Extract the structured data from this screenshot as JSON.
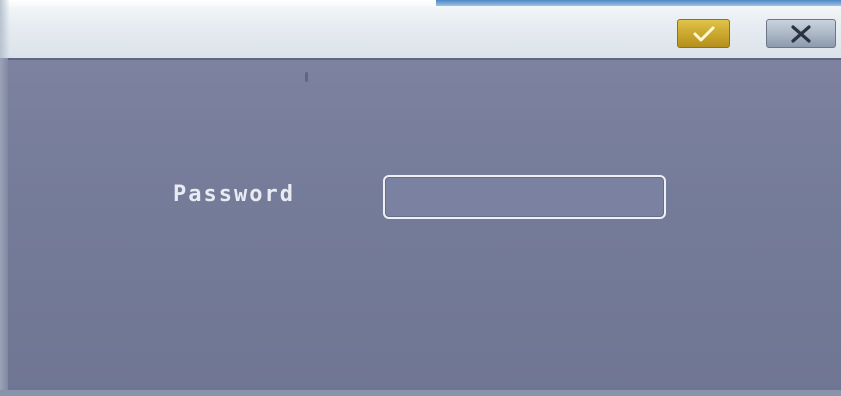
{
  "dialog": {
    "password_label": "Password",
    "password_value": "",
    "ok_icon": "check-icon",
    "cancel_icon": "close-icon"
  },
  "colors": {
    "background": "#757c99",
    "titlebar": "#e6ecf1",
    "ok_button": "#c9a62c",
    "cancel_button": "#a9b5c5",
    "label_text": "#e9ebf2"
  }
}
